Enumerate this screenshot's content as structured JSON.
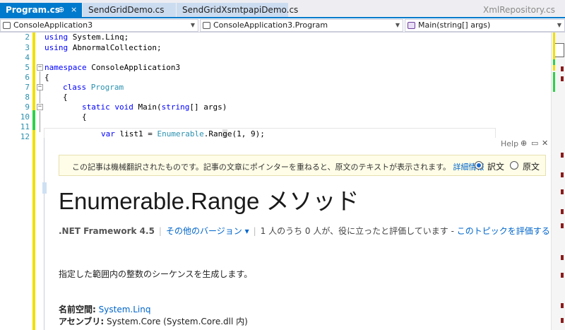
{
  "tabs": {
    "active": "Program.cs",
    "pin_glyph": "⊕",
    "close_glyph": "×",
    "others": [
      "SendGridDemo.cs",
      "SendGridXsmtpapiDemo.cs"
    ],
    "preview": "XmlRepository.cs"
  },
  "navbar": {
    "project": "ConsoleApplication3",
    "type": "ConsoleApplication3.Program",
    "member": "Main(string[] args)"
  },
  "editor": {
    "line_numbers": [
      "2",
      "3",
      "4",
      "5",
      "6",
      "7",
      "8",
      "9",
      "10",
      "11",
      "12"
    ],
    "lines": {
      "l2": [
        "using",
        " System.Linq;"
      ],
      "l3": [
        "using",
        " AbnormalCollection;"
      ],
      "l5": [
        "namespace",
        " ConsoleApplication3"
      ],
      "l6": "{",
      "l7": [
        "class",
        "Program"
      ],
      "l8": "{",
      "l9": [
        "static",
        "void",
        " Main(",
        "string",
        "[] args)"
      ],
      "l10": "{",
      "l12": [
        "var",
        " list1 = ",
        "Enumerable",
        ".Ran",
        "g",
        "e(1, 9);"
      ]
    }
  },
  "help": {
    "title": "Help",
    "machine_translation_notice": "この記事は機械翻訳されたものです。記事の文章にポインターを重ねると、原文のテキストが表示されます。",
    "details_link": "詳細情報",
    "radio_translated": "訳文",
    "radio_original": "原文",
    "page_title": "Enumerable.Range メソッド",
    "framework": ".NET Framework 4.5",
    "other_versions": "その他のバージョン",
    "rating_text": "1 人のうち 0 人が、役に立ったと評価しています -",
    "rate_link": "このトピックを評価する",
    "description": "指定した範囲内の整数のシーケンスを生成します。",
    "namespace_label": "名前空間:",
    "namespace_value": "System.Linq",
    "assembly_label": "アセンブリ:",
    "assembly_value": "System.Core (System.Core.dll 内)"
  }
}
